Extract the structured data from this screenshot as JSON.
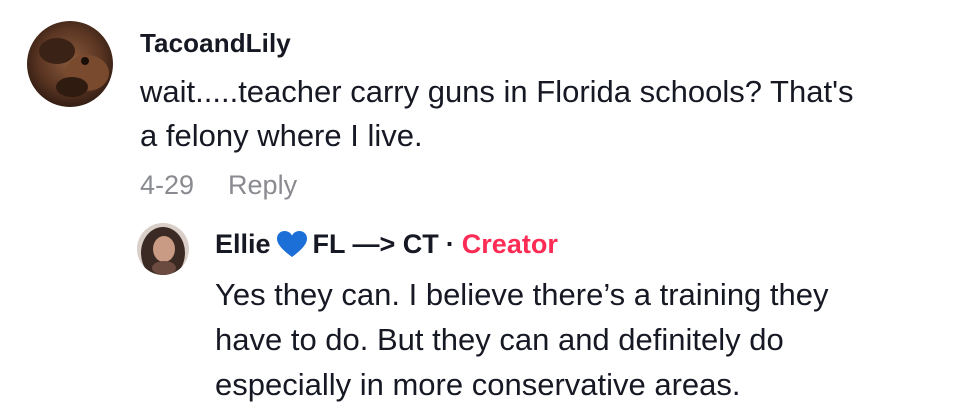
{
  "comment": {
    "username": "TacoandLily",
    "text_line1": "wait.....teacher carry guns in Florida schools? That's",
    "text_line2": "a felony where I live.",
    "date": "4-29",
    "reply_label": "Reply"
  },
  "reply": {
    "username": "Ellie",
    "heart_icon": "blue-heart-icon",
    "heart_color": "#1d6fd8",
    "username_suffix": "FL —> CT",
    "separator": "·",
    "creator_label": "Creator",
    "creator_color": "#fe2c55",
    "text_line1": "Yes they can. I believe there’s a training they",
    "text_line2": "have to do. But they can and definitely do",
    "text_line3": "especially in more conservative areas."
  }
}
